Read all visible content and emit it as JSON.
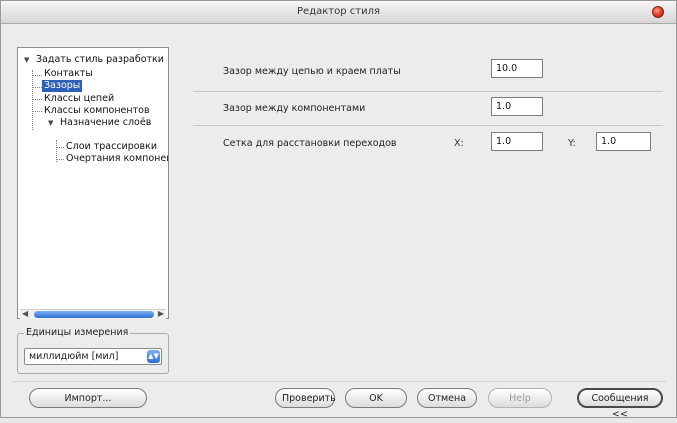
{
  "window": {
    "title": "Редактор стиля"
  },
  "tree": {
    "items": [
      {
        "label": "Задать стиль разработки",
        "expanded": true
      },
      {
        "label": "Контакты"
      },
      {
        "label": "Зазоры",
        "selected": true
      },
      {
        "label": "Классы цепей"
      },
      {
        "label": "Классы компонентов"
      },
      {
        "label": "Назначение слоёв",
        "expanded": true
      },
      {
        "label": "Слои трассировки"
      },
      {
        "label": "Очертания компонен"
      }
    ]
  },
  "units": {
    "legend": "Единицы измерения",
    "value": "миллидюйм [мил]"
  },
  "settings": {
    "board_edge_label": "Зазор между цепью и краем платы",
    "board_edge_value": "10.0",
    "component_label": "Зазор между компонентами",
    "component_value": "1.0",
    "grid_label": "Сетка для расстановки переходов",
    "grid_x_label": "X:",
    "grid_x_value": "1.0",
    "grid_y_label": "Y:",
    "grid_y_value": "1.0"
  },
  "buttons": {
    "import": "Импорт...",
    "check": "Проверить",
    "ok": "OK",
    "cancel": "Отмена",
    "help": "Help",
    "messages": "Сообщения <<"
  },
  "colors": {
    "selection": "#2b5fb8",
    "close_button": "#d8321c",
    "scroll_accent": "#2d6fd6"
  }
}
